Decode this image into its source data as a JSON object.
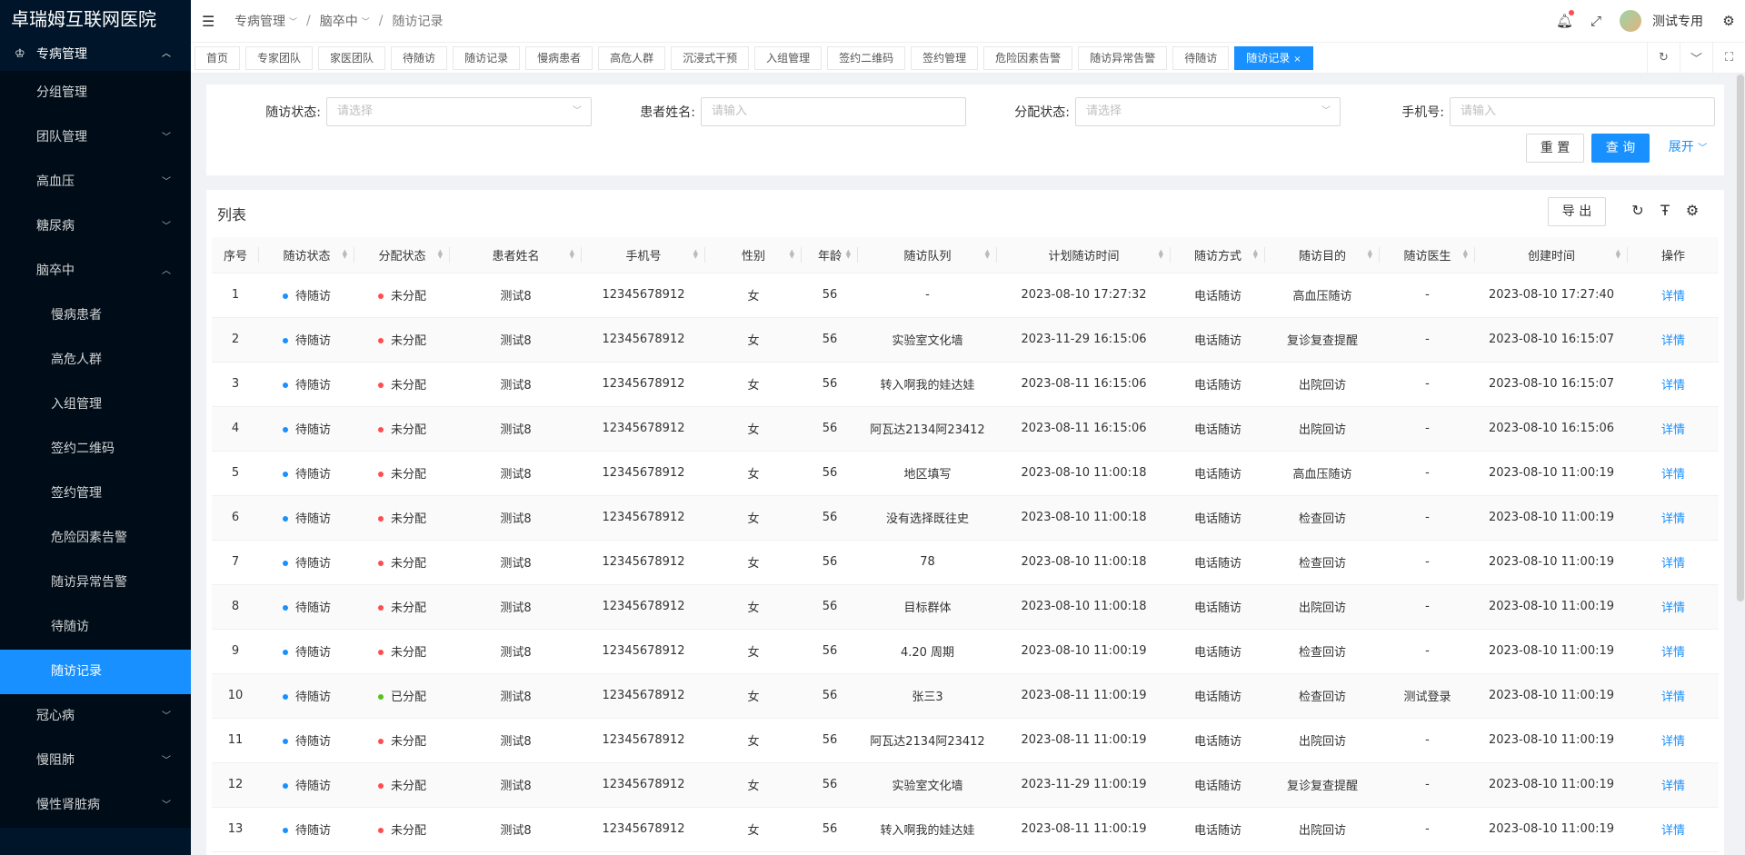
{
  "app": {
    "title": "卓瑞姆互联网医院"
  },
  "colors": {
    "primary": "#1890ff",
    "sidebar_bg": "#001529",
    "status_blue": "#1890ff",
    "status_red": "#ff4d4f",
    "status_green": "#52c41a"
  },
  "sidebar": {
    "group": {
      "label": "专病管理",
      "icon": "disease-icon"
    },
    "items": [
      {
        "label": "分组管理",
        "level": 2,
        "expandable": false
      },
      {
        "label": "团队管理",
        "level": 2,
        "expandable": true
      },
      {
        "label": "高血压",
        "level": 2,
        "expandable": true
      },
      {
        "label": "糖尿病",
        "level": 2,
        "expandable": true
      },
      {
        "label": "脑卒中",
        "level": 2,
        "expandable": true,
        "expanded": true
      },
      {
        "label": "慢病患者",
        "level": 3
      },
      {
        "label": "高危人群",
        "level": 3
      },
      {
        "label": "入组管理",
        "level": 3
      },
      {
        "label": "签约二维码",
        "level": 3
      },
      {
        "label": "签约管理",
        "level": 3
      },
      {
        "label": "危险因素告警",
        "level": 3
      },
      {
        "label": "随访异常告警",
        "level": 3
      },
      {
        "label": "待随访",
        "level": 3
      },
      {
        "label": "随访记录",
        "level": 3,
        "active": true
      },
      {
        "label": "冠心病",
        "level": 2,
        "expandable": true
      },
      {
        "label": "慢阻肺",
        "level": 2,
        "expandable": true
      },
      {
        "label": "慢性肾脏病",
        "level": 2,
        "expandable": true
      }
    ]
  },
  "header": {
    "breadcrumb": [
      "专病管理",
      "脑卒中",
      "随访记录"
    ],
    "username": "测试专用"
  },
  "tabs": [
    {
      "label": "首页"
    },
    {
      "label": "专家团队"
    },
    {
      "label": "家医团队"
    },
    {
      "label": "待随访"
    },
    {
      "label": "随访记录"
    },
    {
      "label": "慢病患者"
    },
    {
      "label": "高危人群"
    },
    {
      "label": "沉浸式干预"
    },
    {
      "label": "入组管理"
    },
    {
      "label": "签约二维码"
    },
    {
      "label": "签约管理"
    },
    {
      "label": "危险因素告警"
    },
    {
      "label": "随访异常告警"
    },
    {
      "label": "待随访"
    },
    {
      "label": "随访记录",
      "active": true,
      "close": "×"
    }
  ],
  "search": {
    "status_label": "随访状态:",
    "status_placeholder": "请选择",
    "name_label": "患者姓名:",
    "name_placeholder": "请输入",
    "assign_label": "分配状态:",
    "assign_placeholder": "请选择",
    "phone_label": "手机号:",
    "phone_placeholder": "请输入",
    "reset": "重 置",
    "query": "查 询",
    "expand": "展开"
  },
  "list": {
    "title": "列表",
    "export": "导 出",
    "columns": [
      "序号",
      "随访状态",
      "分配状态",
      "患者姓名",
      "手机号",
      "性别",
      "年龄",
      "随访队列",
      "计划随访时间",
      "随访方式",
      "随访目的",
      "随访医生",
      "创建时间",
      "操作"
    ],
    "rows": [
      {
        "no": "1",
        "status": "待随访",
        "assign": "未分配",
        "assign_color": "red",
        "name": "测试8",
        "phone": "12345678912",
        "sex": "女",
        "age": "56",
        "queue": "-",
        "plan": "2023-08-10 17:27:32",
        "method": "电话随访",
        "purpose": "高血压随访",
        "doctor": "-",
        "created": "2023-08-10 17:27:40",
        "action": "详情"
      },
      {
        "no": "2",
        "status": "待随访",
        "assign": "未分配",
        "assign_color": "red",
        "name": "测试8",
        "phone": "12345678912",
        "sex": "女",
        "age": "56",
        "queue": "实验室文化墙",
        "plan": "2023-11-29 16:15:06",
        "method": "电话随访",
        "purpose": "复诊复查提醒",
        "doctor": "-",
        "created": "2023-08-10 16:15:07",
        "action": "详情"
      },
      {
        "no": "3",
        "status": "待随访",
        "assign": "未分配",
        "assign_color": "red",
        "name": "测试8",
        "phone": "12345678912",
        "sex": "女",
        "age": "56",
        "queue": "转入啊我的娃达娃",
        "plan": "2023-08-11 16:15:06",
        "method": "电话随访",
        "purpose": "出院回访",
        "doctor": "-",
        "created": "2023-08-10 16:15:07",
        "action": "详情"
      },
      {
        "no": "4",
        "status": "待随访",
        "assign": "未分配",
        "assign_color": "red",
        "name": "测试8",
        "phone": "12345678912",
        "sex": "女",
        "age": "56",
        "queue": "阿瓦达2134阿23412",
        "plan": "2023-08-11 16:15:06",
        "method": "电话随访",
        "purpose": "出院回访",
        "doctor": "-",
        "created": "2023-08-10 16:15:06",
        "action": "详情"
      },
      {
        "no": "5",
        "status": "待随访",
        "assign": "未分配",
        "assign_color": "red",
        "name": "测试8",
        "phone": "12345678912",
        "sex": "女",
        "age": "56",
        "queue": "地区填写",
        "plan": "2023-08-10 11:00:18",
        "method": "电话随访",
        "purpose": "高血压随访",
        "doctor": "-",
        "created": "2023-08-10 11:00:19",
        "action": "详情"
      },
      {
        "no": "6",
        "status": "待随访",
        "assign": "未分配",
        "assign_color": "red",
        "name": "测试8",
        "phone": "12345678912",
        "sex": "女",
        "age": "56",
        "queue": "没有选择既往史",
        "plan": "2023-08-10 11:00:18",
        "method": "电话随访",
        "purpose": "检查回访",
        "doctor": "-",
        "created": "2023-08-10 11:00:19",
        "action": "详情"
      },
      {
        "no": "7",
        "status": "待随访",
        "assign": "未分配",
        "assign_color": "red",
        "name": "测试8",
        "phone": "12345678912",
        "sex": "女",
        "age": "56",
        "queue": "78",
        "plan": "2023-08-10 11:00:18",
        "method": "电话随访",
        "purpose": "检查回访",
        "doctor": "-",
        "created": "2023-08-10 11:00:19",
        "action": "详情"
      },
      {
        "no": "8",
        "status": "待随访",
        "assign": "未分配",
        "assign_color": "red",
        "name": "测试8",
        "phone": "12345678912",
        "sex": "女",
        "age": "56",
        "queue": "目标群体",
        "plan": "2023-08-10 11:00:18",
        "method": "电话随访",
        "purpose": "出院回访",
        "doctor": "-",
        "created": "2023-08-10 11:00:19",
        "action": "详情"
      },
      {
        "no": "9",
        "status": "待随访",
        "assign": "未分配",
        "assign_color": "red",
        "name": "测试8",
        "phone": "12345678912",
        "sex": "女",
        "age": "56",
        "queue": "4.20 周期",
        "plan": "2023-08-10 11:00:19",
        "method": "电话随访",
        "purpose": "检查回访",
        "doctor": "-",
        "created": "2023-08-10 11:00:19",
        "action": "详情"
      },
      {
        "no": "10",
        "status": "待随访",
        "assign": "已分配",
        "assign_color": "green",
        "name": "测试8",
        "phone": "12345678912",
        "sex": "女",
        "age": "56",
        "queue": "张三3",
        "plan": "2023-08-11 11:00:19",
        "method": "电话随访",
        "purpose": "检查回访",
        "doctor": "测试登录",
        "created": "2023-08-10 11:00:19",
        "action": "详情"
      },
      {
        "no": "11",
        "status": "待随访",
        "assign": "未分配",
        "assign_color": "red",
        "name": "测试8",
        "phone": "12345678912",
        "sex": "女",
        "age": "56",
        "queue": "阿瓦达2134阿23412",
        "plan": "2023-08-11 11:00:19",
        "method": "电话随访",
        "purpose": "出院回访",
        "doctor": "-",
        "created": "2023-08-10 11:00:19",
        "action": "详情"
      },
      {
        "no": "12",
        "status": "待随访",
        "assign": "未分配",
        "assign_color": "red",
        "name": "测试8",
        "phone": "12345678912",
        "sex": "女",
        "age": "56",
        "queue": "实验室文化墙",
        "plan": "2023-11-29 11:00:19",
        "method": "电话随访",
        "purpose": "复诊复查提醒",
        "doctor": "-",
        "created": "2023-08-10 11:00:19",
        "action": "详情"
      },
      {
        "no": "13",
        "status": "待随访",
        "assign": "未分配",
        "assign_color": "red",
        "name": "测试8",
        "phone": "12345678912",
        "sex": "女",
        "age": "56",
        "queue": "转入啊我的娃达娃",
        "plan": "2023-08-11 11:00:19",
        "method": "电话随访",
        "purpose": "出院回访",
        "doctor": "-",
        "created": "2023-08-10 11:00:19",
        "action": "详情"
      }
    ]
  }
}
